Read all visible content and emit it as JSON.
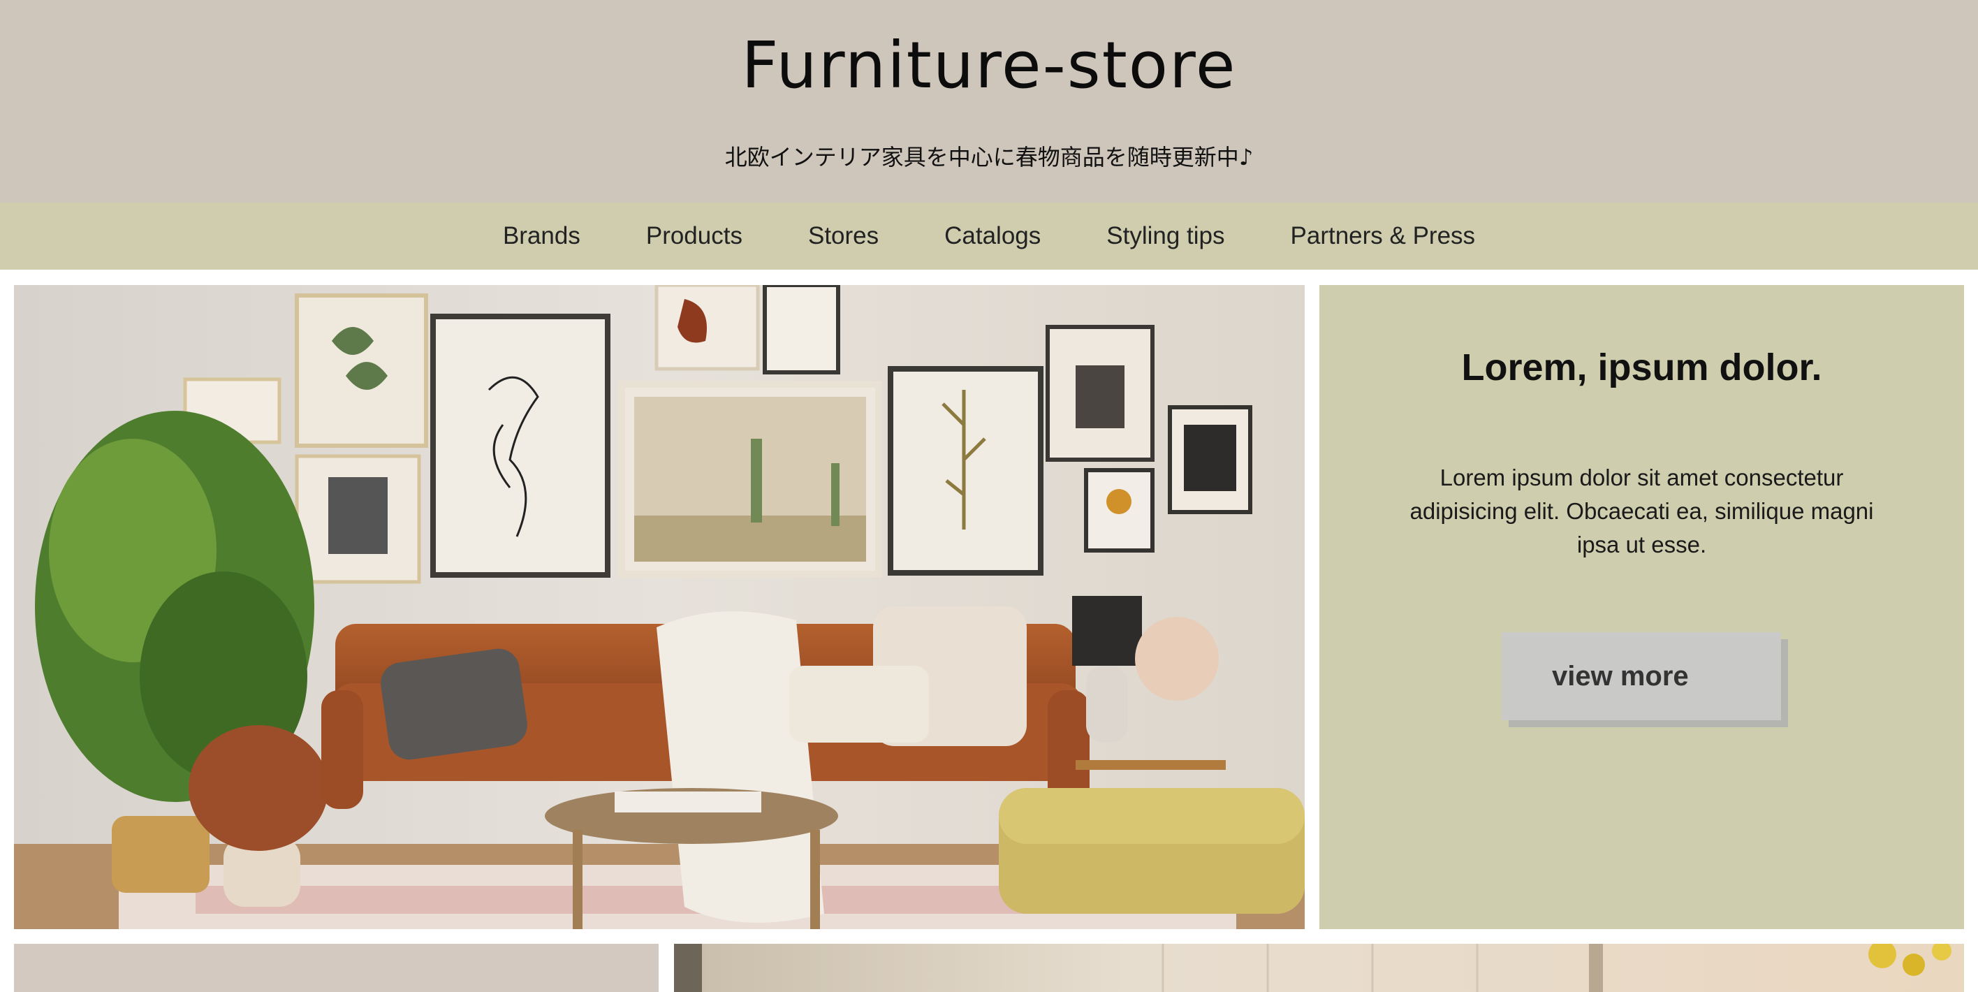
{
  "header": {
    "title": "Furniture-store",
    "tagline": "北欧インテリア家具を中心に春物商品を随時更新中♪"
  },
  "nav": {
    "items": [
      {
        "label": "Brands"
      },
      {
        "label": "Products"
      },
      {
        "label": "Stores"
      },
      {
        "label": "Catalogs"
      },
      {
        "label": "Styling tips"
      },
      {
        "label": "Partners & Press"
      }
    ]
  },
  "hero": {
    "heading": "Lorem, ipsum dolor.",
    "text": "Lorem ipsum dolor sit amet consectetur adipisicing elit. Obcaecati ea, similique magni ipsa ut esse.",
    "button_label": "view more"
  },
  "colors": {
    "header_bg": "#cfc6bb",
    "nav_bg": "#cfcdae",
    "panel_bg": "#cecdad",
    "button_bg": "#c9c9c7"
  }
}
